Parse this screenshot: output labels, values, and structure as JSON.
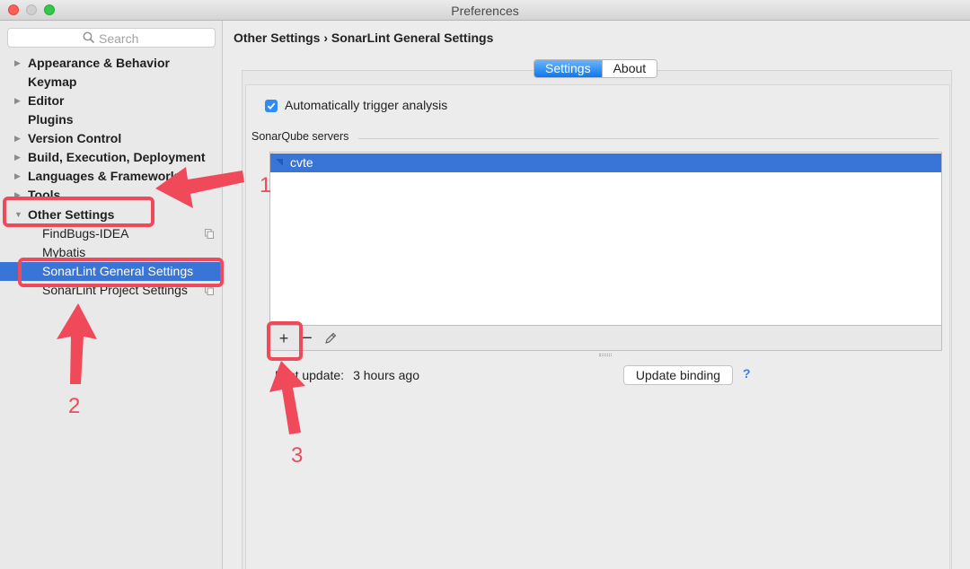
{
  "window": {
    "title": "Preferences"
  },
  "sidebar": {
    "search_placeholder": "Search",
    "items": [
      {
        "label": "Appearance & Behavior",
        "expandable": true
      },
      {
        "label": "Keymap",
        "expandable": false
      },
      {
        "label": "Editor",
        "expandable": true
      },
      {
        "label": "Plugins",
        "expandable": false
      },
      {
        "label": "Version Control",
        "expandable": true
      },
      {
        "label": "Build, Execution, Deployment",
        "expandable": true
      },
      {
        "label": "Languages & Frameworks",
        "expandable": true
      },
      {
        "label": "Tools",
        "expandable": true
      },
      {
        "label": "Other Settings",
        "expandable": true,
        "expanded": true
      },
      {
        "label": "FindBugs-IDEA",
        "child": true,
        "project_icon": true
      },
      {
        "label": "Mybatis",
        "child": true
      },
      {
        "label": "SonarLint General Settings",
        "child": true,
        "selected": true
      },
      {
        "label": "SonarLint Project Settings",
        "child": true,
        "project_icon": true
      }
    ]
  },
  "main": {
    "breadcrumb": "Other Settings › SonarLint General Settings",
    "tabs": [
      {
        "label": "Settings",
        "active": true
      },
      {
        "label": "About",
        "active": false
      }
    ],
    "auto_trigger": {
      "label": "Automatically trigger analysis",
      "checked": true
    },
    "servers_group_label": "SonarQube servers",
    "servers": [
      "cvte"
    ],
    "toolbar": {
      "add": "+",
      "remove": "−",
      "edit_icon": "pencil-icon"
    },
    "last_update": {
      "label": "Last update:",
      "value": "3 hours ago"
    },
    "update_binding_label": "Update binding",
    "help_label": "?"
  },
  "annotations": {
    "color": "#f04a5a",
    "steps": [
      "1",
      "2",
      "3"
    ]
  }
}
